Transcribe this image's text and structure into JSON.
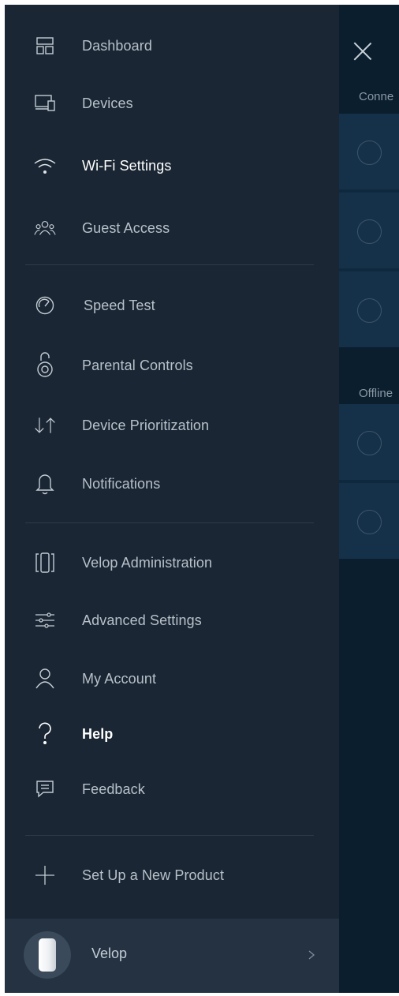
{
  "menu": [
    {
      "label": "Dashboard",
      "icon": "dashboard-icon"
    },
    {
      "label": "Devices",
      "icon": "devices-icon"
    },
    {
      "label": "Wi-Fi Settings",
      "icon": "wifi-icon"
    },
    {
      "label": "Guest Access",
      "icon": "guest-access-icon"
    },
    {
      "label": "Speed Test",
      "icon": "speedometer-icon"
    },
    {
      "label": "Parental Controls",
      "icon": "lock-icon"
    },
    {
      "label": "Device Prioritization",
      "icon": "priority-arrows-icon"
    },
    {
      "label": "Notifications",
      "icon": "bell-icon"
    },
    {
      "label": "Velop Administration",
      "icon": "velop-node-icon"
    },
    {
      "label": "Advanced Settings",
      "icon": "sliders-icon"
    },
    {
      "label": "My Account",
      "icon": "user-icon"
    },
    {
      "label": "Help",
      "icon": "question-icon"
    },
    {
      "label": "Feedback",
      "icon": "chat-bubble-icon"
    },
    {
      "label": "Set Up a New Product",
      "icon": "plus-icon"
    }
  ],
  "footer": {
    "label": "Velop"
  },
  "background": {
    "section_connected": "Conne",
    "section_offline": "Offline"
  },
  "colors": {
    "drawer": "#1a2633",
    "accent_text": "#ffffff",
    "muted_text": "#b7c1ca"
  }
}
